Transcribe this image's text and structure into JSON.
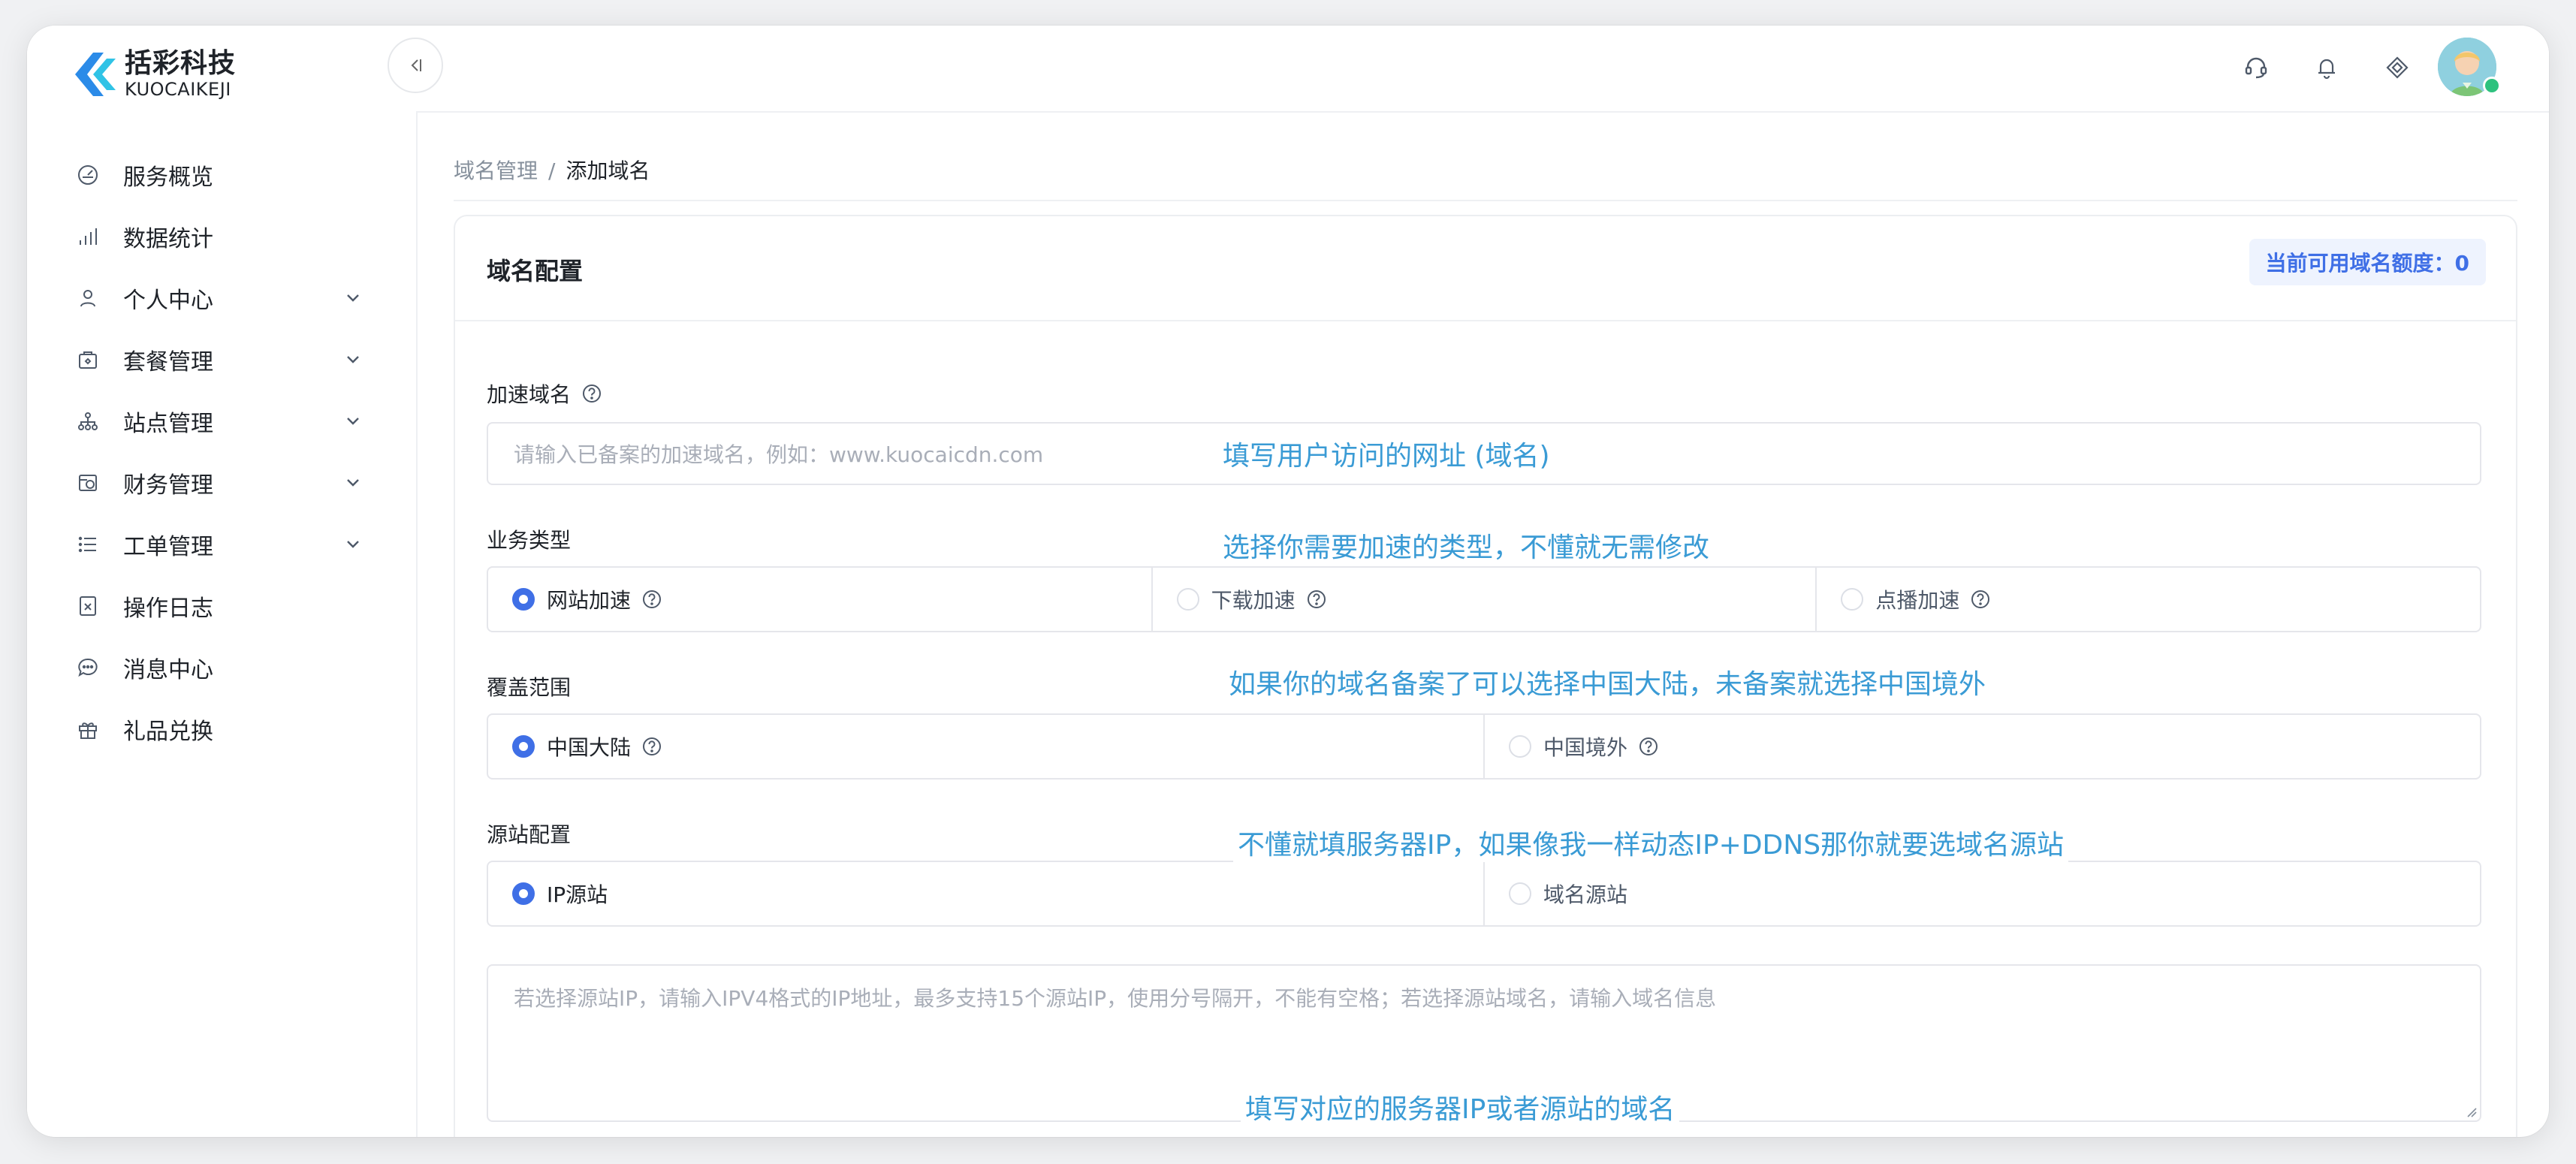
{
  "brand": {
    "name_cn": "括彩科技",
    "name_en": "KUOCAIKEJI",
    "accent": "#3f6fe6",
    "logo_blue": "#2b8be8",
    "logo_cyan": "#30c3e6"
  },
  "sidebar": {
    "collapse_icon": "collapse-left-icon",
    "items": [
      {
        "label": "服务概览",
        "icon": "dashboard-icon",
        "expandable": false
      },
      {
        "label": "数据统计",
        "icon": "bar-chart-icon",
        "expandable": false
      },
      {
        "label": "个人中心",
        "icon": "user-icon",
        "expandable": true
      },
      {
        "label": "套餐管理",
        "icon": "package-icon",
        "expandable": true
      },
      {
        "label": "站点管理",
        "icon": "sitemap-icon",
        "expandable": true
      },
      {
        "label": "财务管理",
        "icon": "finance-icon",
        "expandable": true
      },
      {
        "label": "工单管理",
        "icon": "list-icon",
        "expandable": true
      },
      {
        "label": "操作日志",
        "icon": "log-icon",
        "expandable": false
      },
      {
        "label": "消息中心",
        "icon": "message-icon",
        "expandable": false
      },
      {
        "label": "礼品兑换",
        "icon": "gift-icon",
        "expandable": false
      }
    ]
  },
  "header": {
    "icons": [
      "support-icon",
      "bell-icon",
      "diamond-icon"
    ],
    "avatar": "avatar"
  },
  "breadcrumb": {
    "parent": "域名管理",
    "separator": "/",
    "current": "添加域名"
  },
  "card": {
    "title": "域名配置",
    "quota": "当前可用域名额度：0",
    "domain_field": {
      "label": "加速域名",
      "placeholder": "请输入已备案的加速域名，例如：www.kuocaicdn.com"
    },
    "business_type": {
      "label": "业务类型",
      "options": [
        {
          "label": "网站加速",
          "selected": true
        },
        {
          "label": "下载加速",
          "selected": false
        },
        {
          "label": "点播加速",
          "selected": false
        }
      ]
    },
    "coverage": {
      "label": "覆盖范围",
      "options": [
        {
          "label": "中国大陆",
          "selected": true
        },
        {
          "label": "中国境外",
          "selected": false
        }
      ]
    },
    "origin": {
      "label": "源站配置",
      "options": [
        {
          "label": "IP源站",
          "selected": true
        },
        {
          "label": "域名源站",
          "selected": false
        }
      ],
      "textarea_placeholder": "若选择源站IP，请输入IPV4格式的IP地址，最多支持15个源站IP，使用分号隔开，不能有空格；若选择源站域名，请输入域名信息"
    }
  },
  "annotations": {
    "a1": "填写用户访问的网址 (域名)",
    "a2": "选择你需要加速的类型，不懂就无需修改",
    "a3": "如果你的域名备案了可以选择中国大陆，未备案就选择中国境外",
    "a4": "不懂就填服务器IP，如果像我一样动态IP+DDNS那你就要选域名源站",
    "a5": "填写对应的服务器IP或者源站的域名",
    "color": "#3a9bd5"
  }
}
